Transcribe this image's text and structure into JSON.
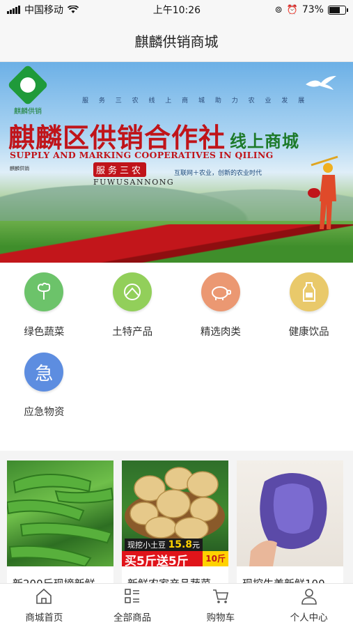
{
  "status_bar": {
    "carrier": "中国移动",
    "time": "上午10:26",
    "battery": "73%",
    "battery_level": 0.73
  },
  "header": {
    "title": "麒麟供销商城"
  },
  "banner": {
    "logo_text": "麒麟供销",
    "slogan": "服 务 三 农    线 上 商 城 助 力 农 业 发 展",
    "title": "麒麟区供销合作社",
    "title_suffix": "线上商城",
    "english": "SUPPLY AND MARKING COOPERATIVES IN QILING",
    "side_text": "麒麟供销",
    "service": "服务三农",
    "service_en": "FUWUSANNONG",
    "tagline": "互联网＋农业，创新的农业时代"
  },
  "categories": [
    {
      "label": "绿色蔬菜",
      "icon": "vegetable-icon",
      "color": "#6cc36a"
    },
    {
      "label": "土特产品",
      "icon": "specialty-icon",
      "color": "#92cf5a"
    },
    {
      "label": "精选肉类",
      "icon": "pig-icon",
      "color": "#eb9872"
    },
    {
      "label": "健康饮品",
      "icon": "drink-icon",
      "color": "#e9c96a"
    },
    {
      "label": "应急物资",
      "icon": "emergency-icon",
      "color": "#5d8de0",
      "glyph": "急"
    }
  ],
  "products": [
    {
      "name": "新200斤现摘新鲜"
    },
    {
      "name": "新鲜农家产品蔬菜",
      "badge_line1": "现挖小土豆",
      "badge_price": "15.8",
      "badge_unit": "元",
      "badge_line2": "买5斤送5斤",
      "badge_weight": "10斤"
    },
    {
      "name": "现挖生姜新鲜100"
    }
  ],
  "tabbar": [
    {
      "label": "商城首页",
      "icon": "home-icon"
    },
    {
      "label": "全部商品",
      "icon": "list-icon"
    },
    {
      "label": "购物车",
      "icon": "cart-icon"
    },
    {
      "label": "个人中心",
      "icon": "user-icon"
    }
  ]
}
